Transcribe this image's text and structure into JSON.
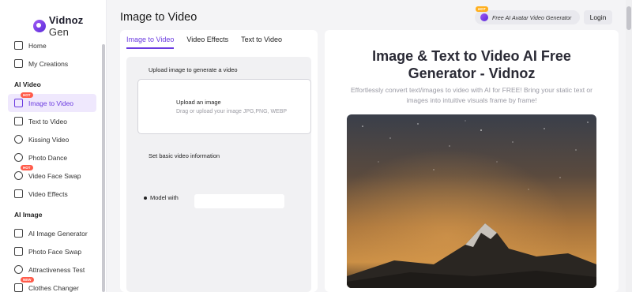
{
  "app": {
    "logo_text": "Vidnoz",
    "logo_suffix": "Gen",
    "page_title": "Image to Video"
  },
  "header": {
    "promo_badge": "HOT",
    "promo_label": "Free AI Avatar Video Generator",
    "login_label": "Login"
  },
  "sidebar": {
    "top_items": [
      {
        "label": "Home",
        "icon": "home-icon"
      },
      {
        "label": "My Creations",
        "icon": "folder-icon"
      }
    ],
    "sections": [
      {
        "title": "AI Video",
        "items": [
          {
            "label": "Image to Video",
            "icon": "image-video-icon",
            "badge": "HOT",
            "active": true
          },
          {
            "label": "Text to Video",
            "icon": "text-video-icon"
          },
          {
            "label": "Kissing Video",
            "icon": "kiss-icon"
          },
          {
            "label": "Photo Dance",
            "icon": "dance-icon"
          },
          {
            "label": "Video Face Swap",
            "icon": "face-swap-icon",
            "badge": "HOT"
          },
          {
            "label": "Video Effects",
            "icon": "effects-icon"
          }
        ]
      },
      {
        "title": "AI Image",
        "items": [
          {
            "label": "AI Image Generator",
            "icon": "image-generator-icon"
          },
          {
            "label": "Photo Face Swap",
            "icon": "photo-swap-icon"
          },
          {
            "label": "Attractiveness Test",
            "icon": "test-icon"
          },
          {
            "label": "Clothes Changer",
            "icon": "clothes-icon",
            "badge": "NEW"
          }
        ]
      }
    ]
  },
  "tabs": [
    {
      "label": "Image to Video",
      "active": true
    },
    {
      "label": "Video Effects"
    },
    {
      "label": "Text to Video"
    }
  ],
  "form": {
    "upload_section_label": "Upload image to generate a video",
    "upload_title": "Upload an image",
    "upload_hint": "Drag or upload your image JPG,PNG, WEBP",
    "info_section_label": "Set basic video information",
    "model_label": "Model with",
    "model_value": ""
  },
  "hero": {
    "title_line1": "Image & Text to Video AI Free",
    "title_line2": "Generator - Vidnoz",
    "description": "Effortlessly convert text/images to video with AI for FREE! Bring your static text or images into intuitive visuals frame by frame!"
  },
  "colors": {
    "accent": "#6b3be0",
    "active_bg": "#efe8fd",
    "hot_badge": "#ff5b4a"
  }
}
